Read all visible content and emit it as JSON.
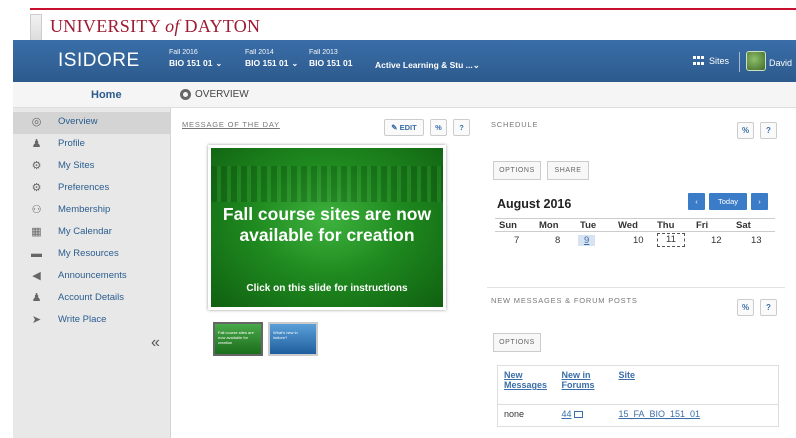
{
  "university": {
    "name_prefix": "UNIVERSITY ",
    "name_of": "of",
    "name_suffix": " DAYTON"
  },
  "header": {
    "brand": "ISIDORE",
    "terms": [
      {
        "term": "Fall 2016",
        "course": "BIO 151 01"
      },
      {
        "term": "Fall 2014",
        "course": "BIO 151 01"
      },
      {
        "term": "Fall 2013",
        "course": "BIO 151 01"
      }
    ],
    "active_site": "Active Learning & Stu ...",
    "sites_label": "Sites",
    "user_name": "David",
    "chevron": "⌄"
  },
  "subheader": {
    "home": "Home",
    "overview": "OVERVIEW"
  },
  "sidebar": {
    "items": [
      {
        "label": "Overview",
        "icon": "◎"
      },
      {
        "label": "Profile",
        "icon": "♟"
      },
      {
        "label": "My Sites",
        "icon": "⚙"
      },
      {
        "label": "Preferences",
        "icon": "⚙"
      },
      {
        "label": "Membership",
        "icon": "⚇"
      },
      {
        "label": "My Calendar",
        "icon": "▦"
      },
      {
        "label": "My Resources",
        "icon": "▬"
      },
      {
        "label": "Announcements",
        "icon": "◀"
      },
      {
        "label": "Account Details",
        "icon": "♟"
      },
      {
        "label": "Write Place",
        "icon": "➤"
      }
    ],
    "collapse": "«"
  },
  "motd": {
    "label": "MESSAGE OF THE DAY",
    "edit": "✎ EDIT",
    "link": "%",
    "help": "?",
    "slide_title": "Fall course sites are now available for creation",
    "slide_sub": "Click on this slide for instructions",
    "thumb1": "Fall course sites are now available for creation",
    "thumb2": "What's new in Isidore?"
  },
  "schedule": {
    "label": "SCHEDULE",
    "link": "%",
    "help": "?",
    "options": "OPTIONS",
    "share": "SHARE",
    "month": "August 2016",
    "prev": "‹",
    "today": "Today",
    "next": "›",
    "days": [
      "Sun",
      "Mon",
      "Tue",
      "Wed",
      "Thu",
      "Fri",
      "Sat"
    ],
    "dates": [
      "7",
      "8",
      "9",
      "10",
      "11",
      "12",
      "13"
    ]
  },
  "messages": {
    "label": "NEW MESSAGES & FORUM POSTS",
    "link": "%",
    "help": "?",
    "options": "OPTIONS",
    "headers": [
      "New Messages",
      "New in Forums",
      "Site"
    ],
    "rows": [
      {
        "messages": "none",
        "forums": "44",
        "site": "15_FA_BIO_151_01"
      }
    ]
  }
}
